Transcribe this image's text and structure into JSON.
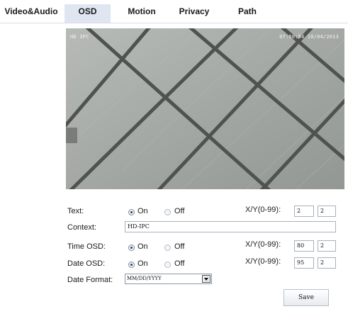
{
  "tabs": [
    {
      "label": "Video&Audio",
      "active": false
    },
    {
      "label": "OSD",
      "active": true
    },
    {
      "label": "Motion",
      "active": false
    },
    {
      "label": "Privacy",
      "active": false
    },
    {
      "label": "Path",
      "active": false
    }
  ],
  "preview": {
    "channel_name": "HD IPC",
    "timestamp": "07:50:54 10/04/2013"
  },
  "form": {
    "text_label": "Text:",
    "text_on": "On",
    "text_off": "Off",
    "text_selected": "On",
    "text_xy_label": "X/Y(0-99):",
    "text_x": "2",
    "text_y": "2",
    "context_label": "Context:",
    "context_value": "HD-IPC",
    "time_label": "Time OSD:",
    "time_on": "On",
    "time_off": "Off",
    "time_selected": "On",
    "time_xy_label": "X/Y(0-99):",
    "time_x": "80",
    "time_y": "2",
    "date_label": "Date OSD:",
    "date_on": "On",
    "date_off": "Off",
    "date_selected": "On",
    "date_xy_label": "X/Y(0-99):",
    "date_x": "95",
    "date_y": "2",
    "format_label": "Date Format:",
    "format_value": "MM/DD/YYYY",
    "save_label": "Save"
  }
}
